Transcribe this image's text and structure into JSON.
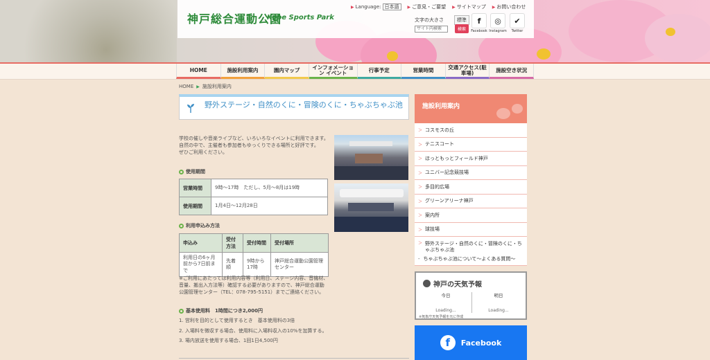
{
  "header": {
    "logo": "神戸総合運動公園",
    "logo_en": "Kobe Sports Park",
    "language_label": "Language:",
    "language_value": "日本語",
    "links": [
      "ご意見・ご要望",
      "サイトマップ",
      "お問い合わせ"
    ],
    "font_size_label": "文字の大きさ",
    "font_size_normal": "標準",
    "font_size_large": "大",
    "search_placeholder": "サイト内検索",
    "search_button": "検索",
    "social": [
      {
        "name": "Facebook",
        "glyph": "f"
      },
      {
        "name": "Instagram",
        "glyph": "◎"
      },
      {
        "name": "Twitter",
        "glyph": "✔"
      }
    ]
  },
  "nav": [
    {
      "label": "HOME"
    },
    {
      "label": "施設利用案内"
    },
    {
      "label": "園内マップ"
    },
    {
      "label": "インフォメーション イベント"
    },
    {
      "label": "行事予定"
    },
    {
      "label": "営業時間"
    },
    {
      "label": "交通アクセス(駐車場)"
    },
    {
      "label": "施設空き状況"
    }
  ],
  "nav_colors": [
    "#e86b62",
    "#f2a13c",
    "#f2c94c",
    "#6bb34a",
    "#3fa9a0",
    "#3f8fc6",
    "#8a6bc6",
    "#d56ba6"
  ],
  "breadcrumb": {
    "home": "HOME",
    "current": "施設利用案内"
  },
  "page": {
    "title": "野外ステージ・自然のくに・冒険のくに・ちゃぶちゃぶ池",
    "intro": [
      "学校の催しや音楽ライブなど、いろいろなイベントに利用できます。",
      "自然の中で、主催者も参加者もゆっくりできる場所と好評です。",
      "ぜひご利用ください。"
    ],
    "usage_heading": "使用期間",
    "usage_rows": [
      {
        "label": "営業時間",
        "value": "9時〜17時　ただし、5月〜8月は19時"
      },
      {
        "label": "使用期間",
        "value": "1月4日〜12月28日"
      }
    ],
    "apply_heading": "利用申込み方法",
    "apply_headers": [
      "申込み",
      "受付方法",
      "受付時間",
      "受付場所"
    ],
    "apply_row": [
      "利用日の6ヶ月前から7日前まで",
      "先着順",
      "9時から17時",
      "神戸総合運動公園管理センター"
    ],
    "note": "※ご利用にあたっては利用内容等（利用日、ステージ内容、音機材、音量、搬出入方法等）確認する必要がありますので、神戸総合運動公園管理センター（TEL：078-795-5151）までご連絡ください。",
    "fee_heading": "基本使用料　1時間につき2,000円",
    "fee_items": [
      "1. 営利を目的として使用するとき　基本使用料の3倍",
      "2. 入場料を徴収する場合、使用料に入場料収入の10%を加算する。",
      "3. 場内放送を使用する場合、1回1日4,500円"
    ]
  },
  "sidebar": {
    "heading": "施設利用案内",
    "items": [
      "コスモスの丘",
      "テニスコート",
      "ほっともっとフィールド神戸",
      "ユニバー記念競技場",
      "多目的広場",
      "グリーンアリーナ神戸",
      "案内所",
      "球技場"
    ],
    "active": "野外ステージ・自然のくに・冒険のくに・ちゃぶちゃぶ池",
    "active_sub": "ちゃぶちゃぶ池について〜よくある質問〜"
  },
  "weather": {
    "title": "神戸の天気予報",
    "today": "今日",
    "tomorrow": "明日",
    "loading": "Loading...",
    "footer": "※気象庁天気予報を元に作成"
  },
  "facebook": {
    "label": "Facebook",
    "glyph": "f"
  }
}
